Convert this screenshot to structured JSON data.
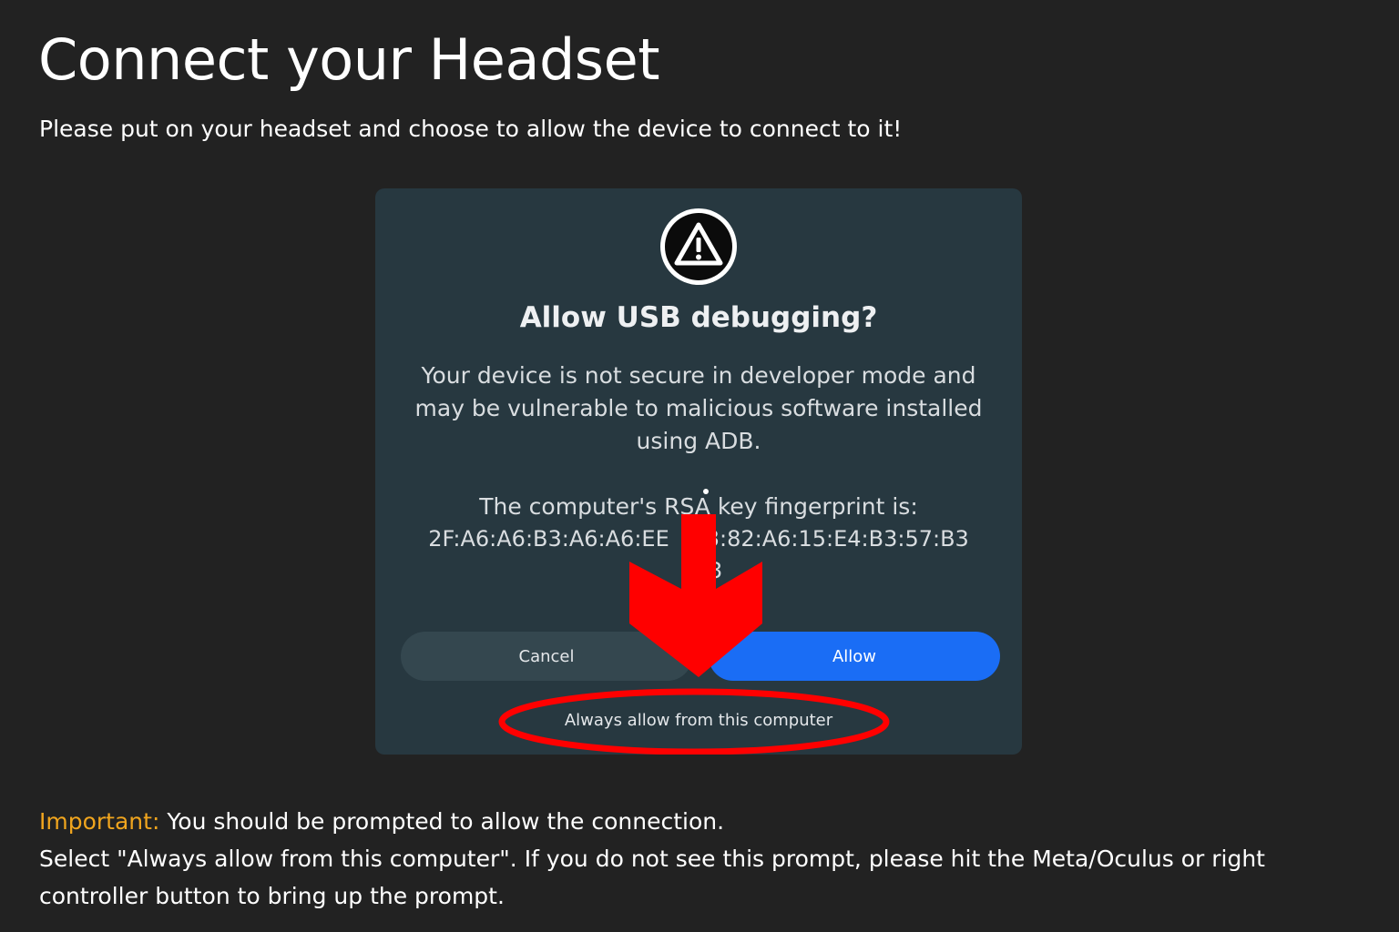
{
  "page": {
    "title": "Connect your Headset",
    "subtitle": "Please put on your headset and choose to allow the device to connect to it!"
  },
  "dialog": {
    "icon": "warning-triangle-icon",
    "title": "Allow USB debugging?",
    "body": "Your device is not secure in developer mode and may be vulnerable to malicious software installed using ADB.",
    "fingerprint_label": "The computer's RSA key fingerprint is:",
    "fingerprint_value_left": "2F:A6:A6:B3:A6:A6:EE",
    "fingerprint_value_right": "3:82:A6:15:E4:B3:57:B3",
    "fingerprint_tail": "3",
    "cancel_label": "Cancel",
    "allow_label": "Allow",
    "always_allow_label": "Always allow from this computer"
  },
  "annotations": {
    "arrow": "red-down-arrow",
    "highlight": "red-ellipse",
    "color": "#ff0000"
  },
  "notice": {
    "label": "Important:",
    "line1": " You should be prompted to allow the connection.",
    "line2": "Select \"Always allow from this computer\". If you do not see this prompt, please hit the Meta/Oculus or right controller button to bring up the prompt."
  },
  "colors": {
    "background": "#222222",
    "dialog": "#273840",
    "allow_button": "#1a6df5",
    "important": "#f0a51e"
  }
}
